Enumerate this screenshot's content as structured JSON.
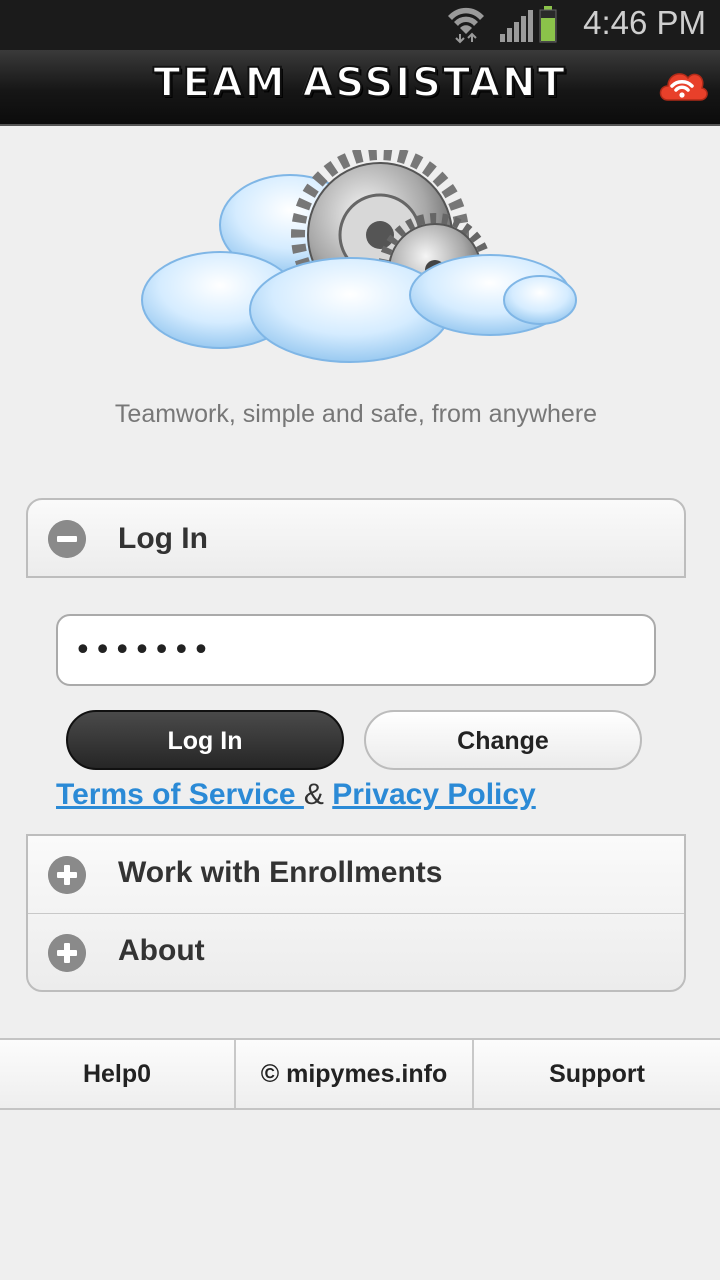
{
  "status_bar": {
    "time": "4:46 PM",
    "battery_color": "#8bc34a"
  },
  "header": {
    "title": "TEAM ASSISTANT",
    "badge_color": "#e8402a"
  },
  "hero": {
    "tagline": "Teamwork, simple and safe, from anywhere"
  },
  "login_panel": {
    "label": "Log In",
    "icon": "minus-circle-icon",
    "expanded": true
  },
  "password": {
    "value": "•••••••"
  },
  "buttons": {
    "login": "Log In",
    "change": "Change"
  },
  "legal": {
    "terms": "Terms of Service ",
    "and": " & ",
    "privacy": "Privacy Policy"
  },
  "menu": [
    {
      "label": "Work with Enrollments",
      "icon": "plus-circle-icon"
    },
    {
      "label": "About",
      "icon": "plus-circle-icon"
    }
  ],
  "footer": {
    "help": "Help0",
    "copyright": "© mipymes.info",
    "support": "Support"
  }
}
